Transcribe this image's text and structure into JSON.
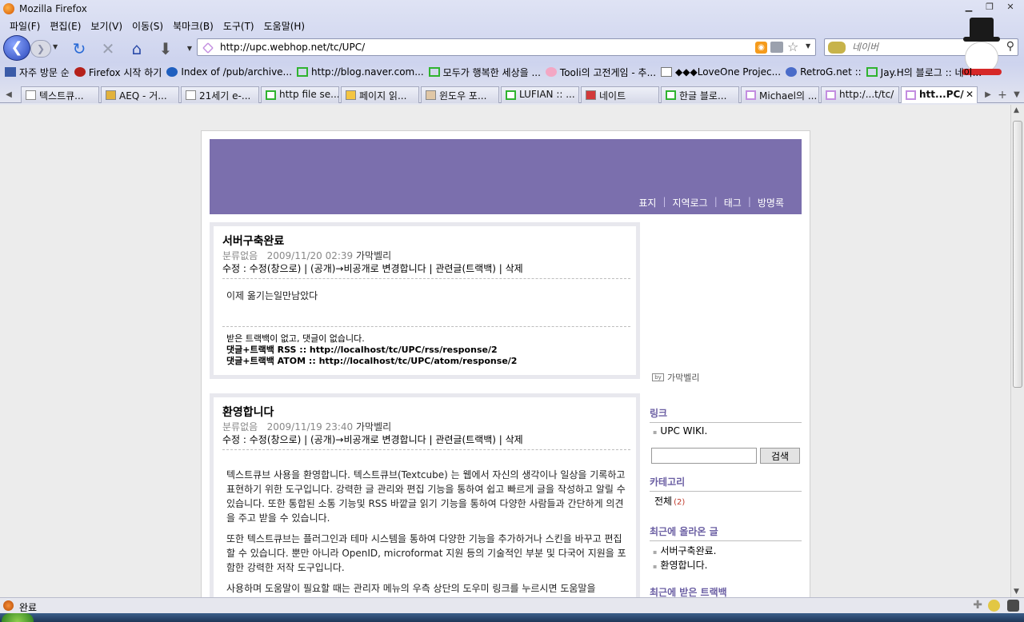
{
  "window": {
    "title": "Mozilla Firefox"
  },
  "menu": [
    "파일(F)",
    "편집(E)",
    "보기(V)",
    "이동(S)",
    "북마크(B)",
    "도구(T)",
    "도움말(H)"
  ],
  "address": {
    "url": "http://upc.webhop.net/tc/UPC/"
  },
  "search": {
    "placeholder": "네이버"
  },
  "bookmarks": [
    "자주 방문 순",
    "Firefox 시작 하기",
    "Index of /pub/archive...",
    "http://blog.naver.com...",
    "모두가 행복한 세상을 ...",
    "Tooli의 고전게임 - 추...",
    "◆◆◆LoveOne Projec...",
    "RetroG.net ::",
    "Jay.H의 블로그 :: 네이..."
  ],
  "tabs": [
    "텍스트큐...",
    "AEQ - 거...",
    "21세기 e-...",
    "http file se...",
    "페이지 읽...",
    "윈도우 포...",
    "LUFIAN :: ...",
    "네이트",
    "한글 블로...",
    "Michael의 ...",
    "http:/...t/tc/",
    "htt...PC/"
  ],
  "blog": {
    "nav": [
      "표지",
      "지역로그",
      "태그",
      "방명록"
    ],
    "posts": [
      {
        "title": "서버구축완료",
        "category": "분류없음",
        "date": "2009/11/20 02:39",
        "author": "가막벨리",
        "actions": "수정 : 수정(창으로) | (공개)→비공개로 변경합니다 | 관련글(트랙백) | 삭제",
        "body": [
          "이제 옮기는일만남았다"
        ],
        "trackback_note": "받은 트랙백이 없고, 댓글이 없습니다.",
        "rss_label": "댓글+트랙백 RSS :: http://localhost/tc/UPC/rss/response/2",
        "atom_label": "댓글+트랙백 ATOM :: http://localhost/tc/UPC/atom/response/2"
      },
      {
        "title": "환영합니다",
        "category": "분류없음",
        "date": "2009/11/19 23:40",
        "author": "가막벨리",
        "actions": "수정 : 수정(창으로) | (공개)→비공개로 변경합니다 | 관련글(트랙백) | 삭제",
        "body": [
          "텍스트큐브 사용을 환영합니다. 텍스트큐브(Textcube) 는 웹에서 자신의 생각이나 일상을 기록하고 표현하기 위한 도구입니다. 강력한 글 관리와 편집 기능을 통하여 쉽고 빠르게 글을 작성하고 알릴 수 있습니다. 또한 통합된 소통 기능및 RSS 바깥글 읽기 기능을 통하여 다양한 사람들과 간단하게 의견을 주고 받을 수 있습니다.",
          "또한 텍스트큐브는 플러그인과 테마 시스템을 통하여 다양한 기능을 추가하거나 스킨을 바꾸고 편집할 수 있습니다. 뿐만 아니라 OpenID, microformat 지원 등의 기술적인 부분 및 다국어 지원을 포함한 강력한 저작 도구입니다.",
          "사용하며 도움말이 필요할 때는 관리자 메뉴의 우측 상단의 도우미 링크를 누르시면 도움말을"
        ]
      }
    ],
    "sidebar": {
      "owner": "가막벨리",
      "links_title": "링크",
      "links": [
        "UPC WIKI."
      ],
      "search_button": "검색",
      "category_title": "카테고리",
      "category_all": "전체",
      "category_count": "(2)",
      "recent_title": "최근에 올라온 글",
      "recent": [
        "서버구축완료.",
        "환영합니다."
      ],
      "trackback_title": "최근에 받은 트랙백"
    }
  },
  "status": {
    "text": "완료"
  }
}
